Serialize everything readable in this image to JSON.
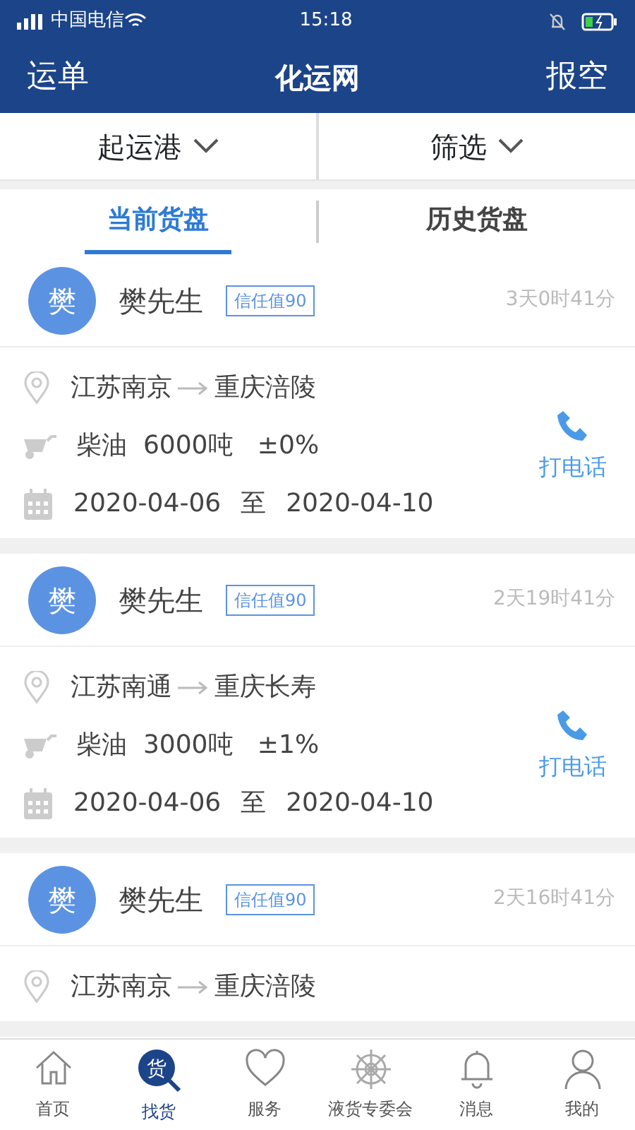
{
  "status_bar": {
    "carrier": "中国电信",
    "time": "15:18"
  },
  "header": {
    "left": "运单",
    "title": "化运网",
    "right": "报空"
  },
  "filters": [
    {
      "label": "起运港"
    },
    {
      "label": "筛选"
    }
  ],
  "tabs": [
    {
      "label": "当前货盘",
      "selected": true
    },
    {
      "label": "历史货盘",
      "selected": false
    }
  ],
  "cards": [
    {
      "avatar": "樊",
      "name": "樊先生",
      "trust": "信任值90",
      "time": "3天0时41分",
      "from": "江苏南京",
      "to": "重庆涪陵",
      "cargo": "柴油  6000吨   ±0%",
      "date_from": "2020-04-06",
      "date_sep": "至",
      "date_to": "2020-04-10",
      "call": "打电话"
    },
    {
      "avatar": "樊",
      "name": "樊先生",
      "trust": "信任值90",
      "time": "2天19时41分",
      "from": "江苏南通",
      "to": "重庆长寿",
      "cargo": "柴油  3000吨   ±1%",
      "date_from": "2020-04-06",
      "date_sep": "至",
      "date_to": "2020-04-10",
      "call": "打电话"
    },
    {
      "avatar": "樊",
      "name": "樊先生",
      "trust": "信任值90",
      "time": "2天16时41分",
      "from": "江苏南京",
      "to": "重庆涪陵"
    }
  ],
  "nav": [
    {
      "kind": "home",
      "label": "首页",
      "selected": false
    },
    {
      "kind": "find",
      "label": "找货",
      "selected": true,
      "icon_text": "货"
    },
    {
      "kind": "heart",
      "label": "服务",
      "selected": false
    },
    {
      "kind": "wheel",
      "label": "液货专委会",
      "selected": false
    },
    {
      "kind": "bell",
      "label": "消息",
      "selected": false
    },
    {
      "kind": "user",
      "label": "我的",
      "selected": false
    }
  ]
}
